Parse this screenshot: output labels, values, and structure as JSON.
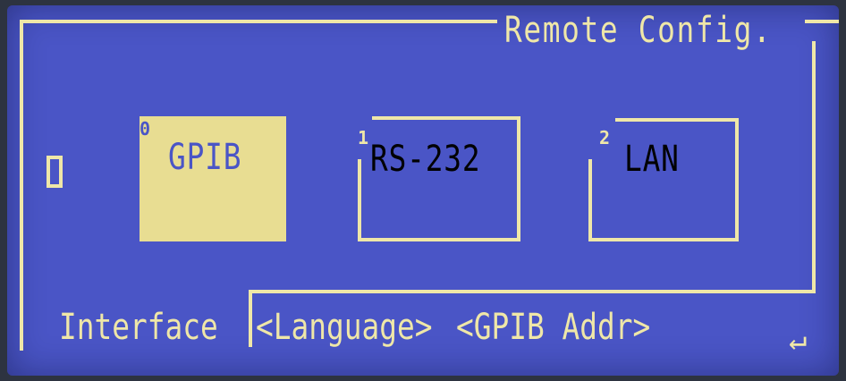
{
  "panel": {
    "title": "Remote Config.",
    "status_box_icon": "empty-square-indicator"
  },
  "interfaces": [
    {
      "index": "0",
      "label": "GPIB",
      "selected": true
    },
    {
      "index": "1",
      "label": "RS-232",
      "selected": false
    },
    {
      "index": "2",
      "label": "LAN",
      "selected": false
    }
  ],
  "softkeys": {
    "interface": "Interface",
    "language": "<Language>",
    "gpib_addr": "<GPIB Addr>",
    "enter_icon": "enter-return-icon",
    "enter_glyph": "↵"
  },
  "colors": {
    "screen_bg": "#4a55c6",
    "foreground": "#efe7a8",
    "selected_fill": "#e8dd92"
  }
}
